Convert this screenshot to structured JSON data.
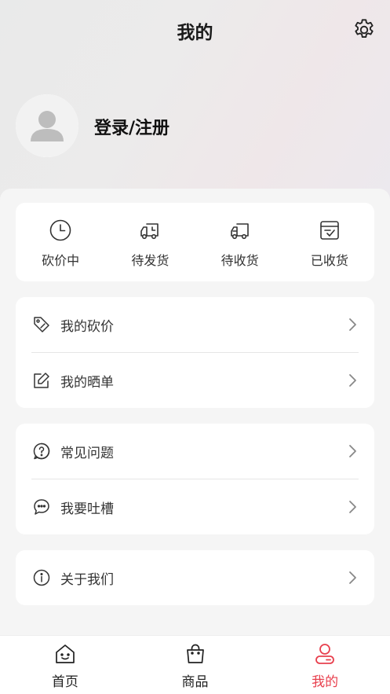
{
  "header": {
    "title": "我的",
    "settings_icon": "gear-icon",
    "login_text": "登录/注册",
    "avatar_icon": "user-placeholder-icon"
  },
  "orders": [
    {
      "label": "砍价中",
      "icon": "clock-icon"
    },
    {
      "label": "待发货",
      "icon": "truck-clock-icon"
    },
    {
      "label": "待收货",
      "icon": "truck-icon"
    },
    {
      "label": "已收货",
      "icon": "received-box-icon"
    }
  ],
  "menu_groups": [
    [
      {
        "label": "我的砍价",
        "icon": "price-tag-icon"
      },
      {
        "label": "我的晒单",
        "icon": "edit-icon"
      }
    ],
    [
      {
        "label": "常见问题",
        "icon": "question-icon"
      },
      {
        "label": "我要吐槽",
        "icon": "chat-icon"
      }
    ],
    [
      {
        "label": "关于我们",
        "icon": "info-icon"
      }
    ]
  ],
  "tabbar": [
    {
      "label": "首页",
      "icon": "home-icon",
      "active": false
    },
    {
      "label": "商品",
      "icon": "shopping-bag-icon",
      "active": false
    },
    {
      "label": "我的",
      "icon": "user-icon",
      "active": true
    }
  ],
  "colors": {
    "accent": "#e8404e",
    "text": "#333333",
    "background": "#f5f5f5"
  }
}
